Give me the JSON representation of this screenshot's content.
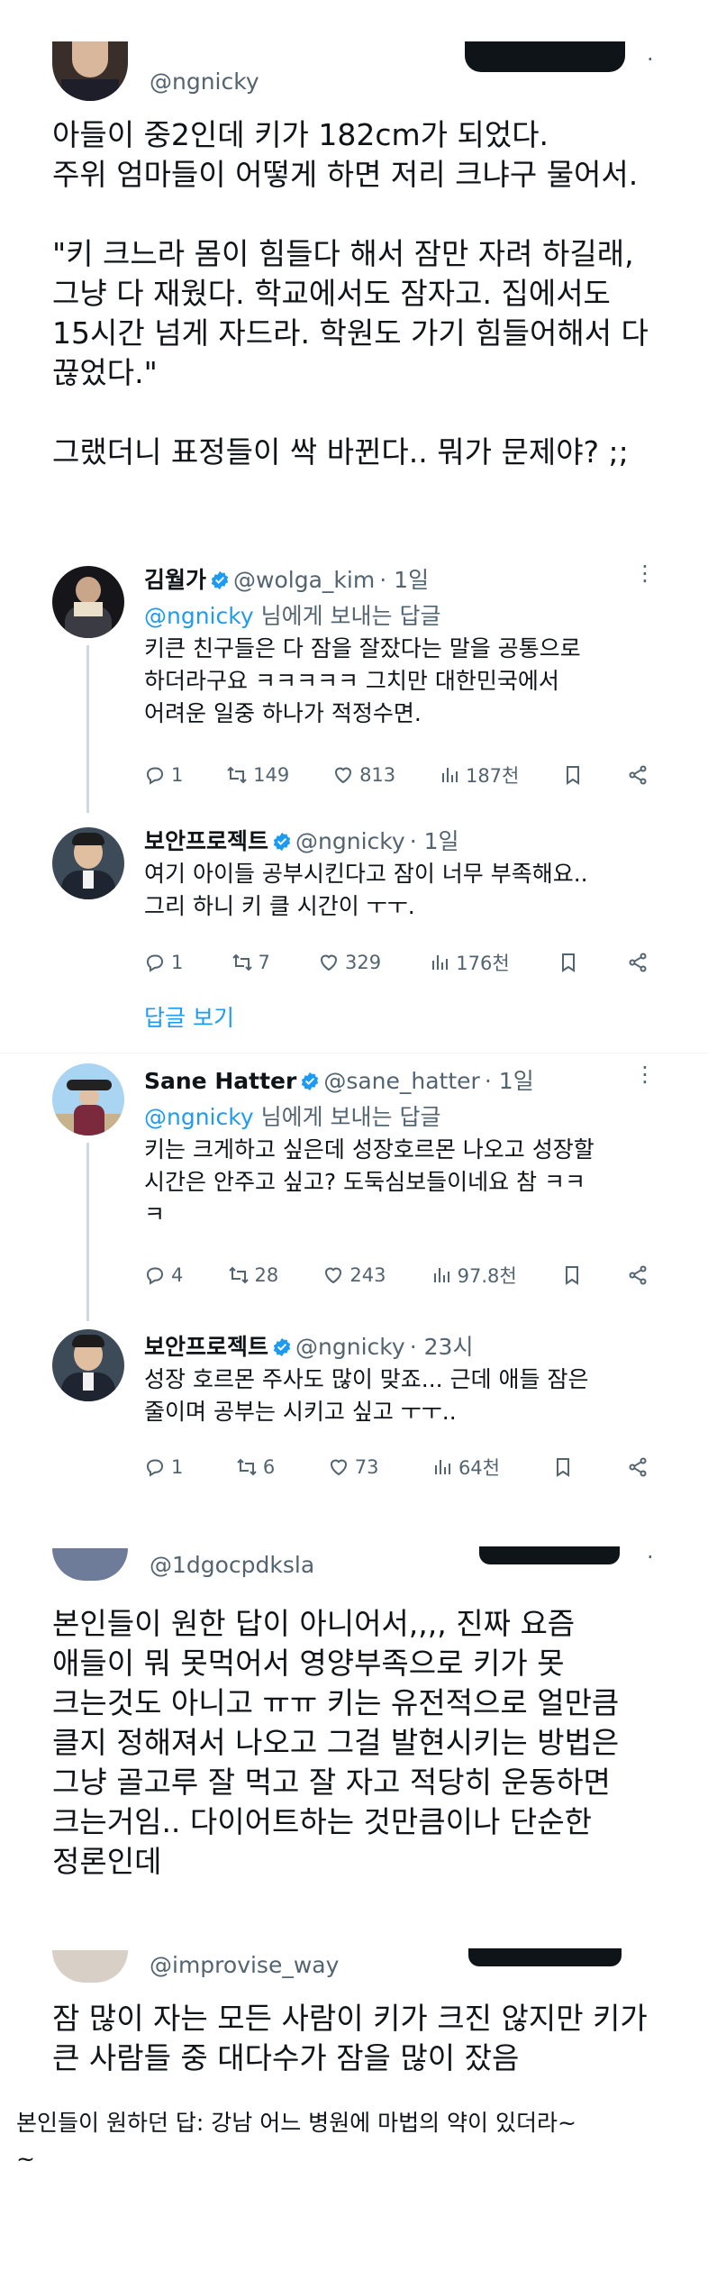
{
  "post1": {
    "handle": "@ngnicky",
    "text": "아들이 중2인데 키가 182cm가 되었다.\n주위 엄마들이 어떻게 하면 저리 크냐구 물어서.\n\n\"키 크느라 몸이 힘들다 해서 잠만 자려 하길래,\n그냥 다 재웠다. 학교에서도 잠자고. 집에서도\n15시간 넘게 자드라. 학원도 가기 힘들어해서 다\n끊었다.\"\n\n그랬더니 표정들이 싹 바뀐다.. 뭐가 문제야? ;;"
  },
  "reply1": {
    "name": "김월가",
    "handle": "@wolga_kim",
    "time": "· 1일",
    "mention": "@ngnicky",
    "reply_suffix": " 님에게 보내는 답글",
    "text": "키큰 친구들은 다 잠을 잘잤다는 말을 공통으로\n하더라구요 ㅋㅋㅋㅋㅋ 그치만 대한민국에서\n어려운 일중 하나가 적정수면.",
    "replies": "1",
    "reposts": "149",
    "likes": "813",
    "views": "187천"
  },
  "reply2": {
    "name": "보안프로젝트",
    "handle": "@ngnicky",
    "time": "· 1일",
    "text": "여기 아이들 공부시킨다고 잠이 너무 부족해요..\n그리 하니 키 클 시간이 ㅜㅜ.",
    "replies": "1",
    "reposts": "7",
    "likes": "329",
    "views": "176천"
  },
  "show_replies": "답글 보기",
  "reply3": {
    "name": "Sane Hatter",
    "handle": "@sane_hatter",
    "time": "· 1일",
    "mention": "@ngnicky",
    "reply_suffix": " 님에게 보내는 답글",
    "text": "키는 크게하고 싶은데 성장호르몬 나오고 성장할\n시간은 안주고 싶고? 도둑심보들이네요 참 ㅋㅋ\nㅋ",
    "replies": "4",
    "reposts": "28",
    "likes": "243",
    "views": "97.8천"
  },
  "reply4": {
    "name": "보안프로젝트",
    "handle": "@ngnicky",
    "time": "· 23시",
    "text": "성장 호르몬 주사도 많이 맞죠... 근데 애들 잠은\n줄이며 공부는 시키고 싶고 ㅜㅜ..",
    "replies": "1",
    "reposts": "6",
    "likes": "73",
    "views": "64천"
  },
  "post2": {
    "handle": "@1dgocpdksla",
    "text": "본인들이 원한 답이 아니어서,,,, 진짜 요즘\n애들이 뭐 못먹어서 영양부족으로 키가 못\n크는것도 아니고 ㅠㅠ 키는 유전적으로 얼만큼\n클지 정해져서 나오고 그걸 발현시키는 방법은\n그냥 골고루 잘 먹고 잘 자고 적당히 운동하면\n크는거임.. 다이어트하는 것만큼이나 단순한\n정론인데"
  },
  "post3": {
    "handle": "@improvise_way",
    "text": "잠 많이 자는 모든 사람이 키가 크진 않지만 키가\n큰 사람들 중 대다수가 잠을 많이 잤음"
  },
  "caption": "본인들이 원하던 답: 강남 어느 병원에 마법의 약이 있더라~\n~",
  "colors": {
    "accent": "#1d9bf0",
    "text": "#0f1419",
    "muted": "#536471"
  }
}
